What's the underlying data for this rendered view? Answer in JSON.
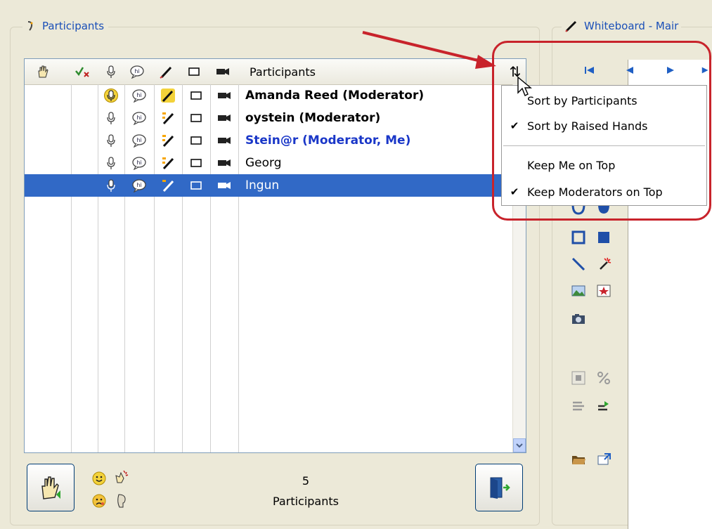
{
  "participants_panel": {
    "title": "Participants",
    "header": {
      "participants_label": "Participants"
    },
    "rows": [
      {
        "name": "Amanda Reed (Moderator)",
        "bold": true,
        "me": false,
        "selected": false,
        "talk_active": true
      },
      {
        "name": "oystein (Moderator)",
        "bold": true,
        "me": false,
        "selected": false,
        "talk_active": false
      },
      {
        "name": "Stein@r (Moderator, Me)",
        "bold": true,
        "me": true,
        "selected": false,
        "talk_active": false
      },
      {
        "name": "Georg",
        "bold": false,
        "me": false,
        "selected": false,
        "talk_active": false
      },
      {
        "name": "Ingun",
        "bold": false,
        "me": false,
        "selected": true,
        "talk_active": false
      }
    ],
    "count": "5",
    "count_label": "Participants"
  },
  "sort_menu": {
    "items": [
      {
        "label": "Sort by Participants",
        "checked": false
      },
      {
        "label": "Sort by Raised Hands",
        "checked": true
      },
      {
        "label": "Keep Me on Top",
        "checked": false
      },
      {
        "label": "Keep Moderators on Top",
        "checked": true
      }
    ]
  },
  "whiteboard_panel": {
    "title": "Whiteboard - Mair"
  },
  "colors": {
    "accent": "#3169c6",
    "highlight": "#c8232b",
    "title_blue": "#1a4fb8",
    "me_blue": "#1a37c8"
  },
  "icons": [
    "hand-icon",
    "check-x-icon",
    "microphone-icon",
    "chat-icon",
    "pencil-icon",
    "video-window-icon",
    "camera-icon",
    "sort-icon",
    "smile-icon",
    "applause-icon",
    "sad-icon",
    "speak-icon",
    "exit-icon"
  ]
}
